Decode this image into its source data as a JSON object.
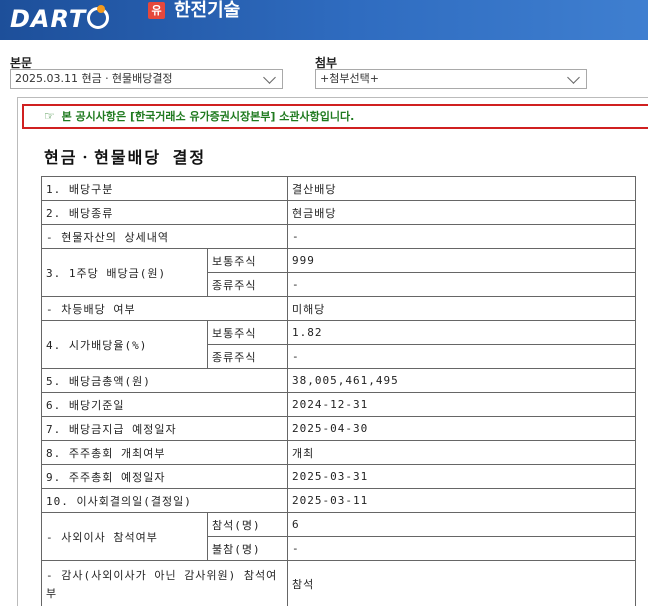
{
  "header": {
    "logo_text": "DART",
    "market_badge": "유",
    "company_name": "한전기술"
  },
  "selectors": {
    "main": {
      "label": "본문",
      "value": "2025.03.11  현금ㆍ현물배당결정"
    },
    "attachment": {
      "label": "첨부",
      "value": "+첨부선택+"
    }
  },
  "notice": {
    "icon": "pointing-hand-icon",
    "text": "본 공시사항은 [한국거래소 유가증권시장본부] 소관사항입니다."
  },
  "document": {
    "title": "현금ㆍ현물배당 결정",
    "rows": {
      "r1": {
        "label": "1. 배당구분",
        "value": "결산배당"
      },
      "r2": {
        "label": "2. 배당종류",
        "value": "현금배당"
      },
      "r3": {
        "label": "- 현물자산의 상세내역",
        "value": "-"
      },
      "r4": {
        "label": "3. 1주당 배당금(원)",
        "sub1": "보통주식",
        "val1": "999",
        "sub2": "종류주식",
        "val2": "-"
      },
      "r5": {
        "label": "- 차등배당 여부",
        "value": "미해당"
      },
      "r6": {
        "label": "4. 시가배당율(%)",
        "sub1": "보통주식",
        "val1": "1.82",
        "sub2": "종류주식",
        "val2": "-"
      },
      "r7": {
        "label": "5. 배당금총액(원)",
        "value": "38,005,461,495"
      },
      "r8": {
        "label": "6. 배당기준일",
        "value": "2024-12-31"
      },
      "r9": {
        "label": "7. 배당금지급 예정일자",
        "value": "2025-04-30"
      },
      "r10": {
        "label": "8. 주주총회 개최여부",
        "value": "개최"
      },
      "r11": {
        "label": "9. 주주총회 예정일자",
        "value": "2025-03-31"
      },
      "r12": {
        "label": "10. 이사회결의일(결정일)",
        "value": "2025-03-11"
      },
      "r13": {
        "label": "- 사외이사 참석여부",
        "sub1": "참석(명)",
        "val1": "6",
        "sub2": "불참(명)",
        "val2": "-"
      },
      "r14": {
        "label": "- 감사(사외이사가 아닌 감사위원) 참석여부",
        "value": "참석"
      }
    }
  },
  "colors": {
    "header_bg": "#2f6cc0",
    "notice_border": "#d02020",
    "notice_text": "#1f7a1f",
    "badge_bg": "#e5483c",
    "logo_accent": "#f39a1e"
  }
}
